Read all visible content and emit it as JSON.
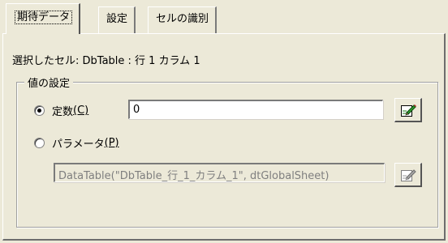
{
  "tabs": [
    {
      "label": "期待データ",
      "active": true
    },
    {
      "label": "設定",
      "active": false
    },
    {
      "label": "セルの識別",
      "active": false
    }
  ],
  "cell_line": "選択したセル: DbTable : 行 1 カラム 1",
  "group": {
    "title": "値の設定"
  },
  "constant": {
    "label": "定数",
    "hotkey": "(C)",
    "selected": true,
    "value": "0",
    "edit_icon": "edit-pencil-icon"
  },
  "parameter": {
    "label": "パラメータ",
    "hotkey": "(P)",
    "selected": false,
    "value": "DataTable(\"DbTable_行_1_カラム_1\", dtGlobalSheet)",
    "edit_icon": "edit-pencil-icon"
  },
  "colors": {
    "background": "#ece9d8",
    "disabled_text": "#7f7f7f"
  }
}
